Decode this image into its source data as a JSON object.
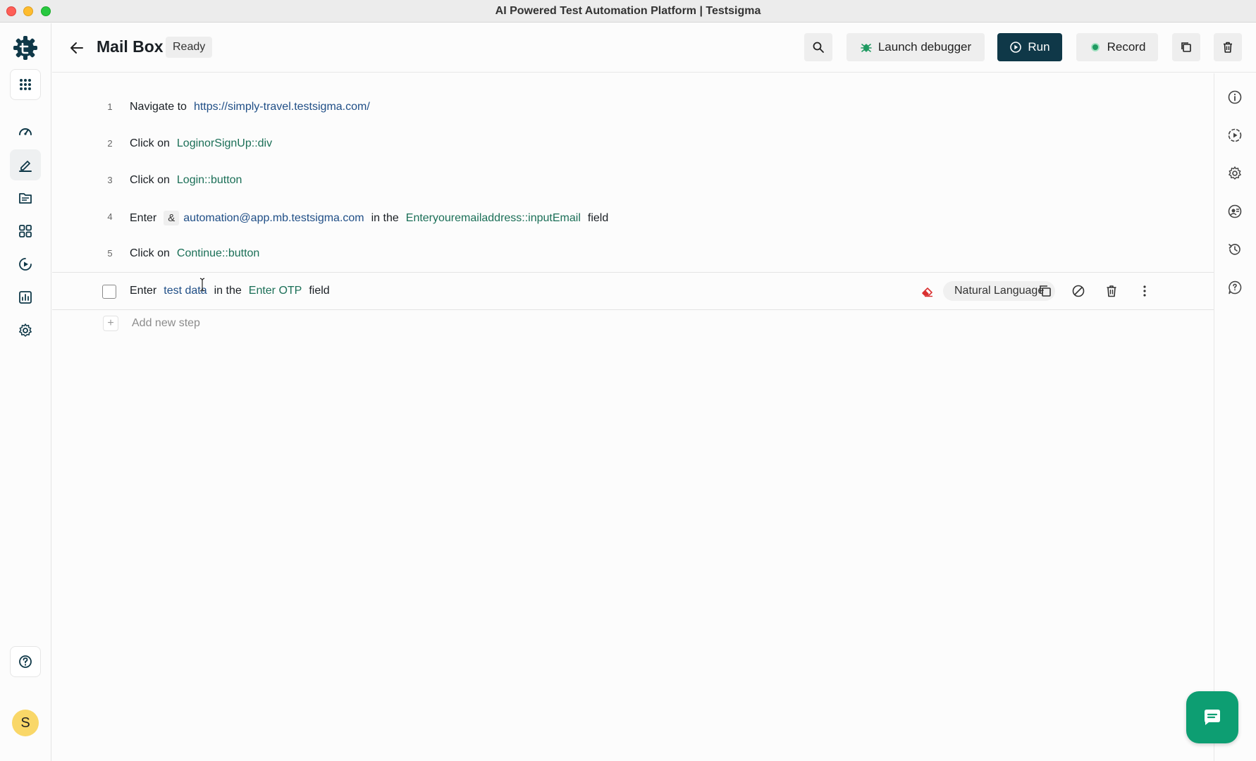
{
  "window": {
    "title": "AI Powered Test Automation Platform | Testsigma"
  },
  "leftnav": {
    "items": [
      {
        "name": "apps-grid",
        "icon": "apps-grid-icon"
      },
      {
        "name": "dashboard",
        "icon": "speedometer-icon"
      },
      {
        "name": "test-cases",
        "icon": "pencil-icon"
      },
      {
        "name": "test-data",
        "icon": "folder-icon"
      },
      {
        "name": "elements",
        "icon": "modules-icon"
      },
      {
        "name": "runs",
        "icon": "play-circle-icon"
      },
      {
        "name": "reports",
        "icon": "bar-chart-icon"
      },
      {
        "name": "settings",
        "icon": "gear-icon"
      },
      {
        "name": "help",
        "icon": "help-icon"
      }
    ],
    "avatar_initial": "S"
  },
  "header": {
    "title": "Mail Box",
    "status": "Ready",
    "buttons": {
      "debugger": "Launch debugger",
      "run": "Run",
      "record": "Record"
    }
  },
  "steps": [
    {
      "num": "1",
      "tokens": [
        {
          "t": "action",
          "v": "Navigate to"
        },
        {
          "t": "url",
          "v": "https://simply-travel.testsigma.com/"
        }
      ]
    },
    {
      "num": "2",
      "tokens": [
        {
          "t": "action",
          "v": "Click on"
        },
        {
          "t": "elem",
          "v": "LoginorSignUp::div"
        }
      ]
    },
    {
      "num": "3",
      "tokens": [
        {
          "t": "action",
          "v": "Click on"
        },
        {
          "t": "elem",
          "v": "Login::button"
        }
      ]
    },
    {
      "num": "4",
      "tokens": [
        {
          "t": "action",
          "v": "Enter"
        },
        {
          "t": "amp",
          "v": "&"
        },
        {
          "t": "data",
          "v": "automation@app.mb.testsigma.com"
        },
        {
          "t": "action",
          "v": "in the"
        },
        {
          "t": "elem",
          "v": "Enteryouremailaddress::inputEmail"
        },
        {
          "t": "action",
          "v": "field"
        }
      ]
    },
    {
      "num": "5",
      "tokens": [
        {
          "t": "action",
          "v": "Click on"
        },
        {
          "t": "elem",
          "v": "Continue::button"
        }
      ]
    }
  ],
  "editing_step": {
    "tokens": [
      {
        "t": "action",
        "v": "Enter"
      },
      {
        "t": "data",
        "v": "test data"
      },
      {
        "t": "action",
        "v": "in the"
      },
      {
        "t": "elem",
        "v": "Enter OTP"
      },
      {
        "t": "action",
        "v": "field"
      }
    ],
    "mode": "Natural Language"
  },
  "add_step_label": "Add new step",
  "colors": {
    "run_button": "#0f3848",
    "element_text": "#1b6f57",
    "data_text": "#1f4e86",
    "chat_fab": "#0d9e72",
    "record_dot": "#1f9a61"
  }
}
